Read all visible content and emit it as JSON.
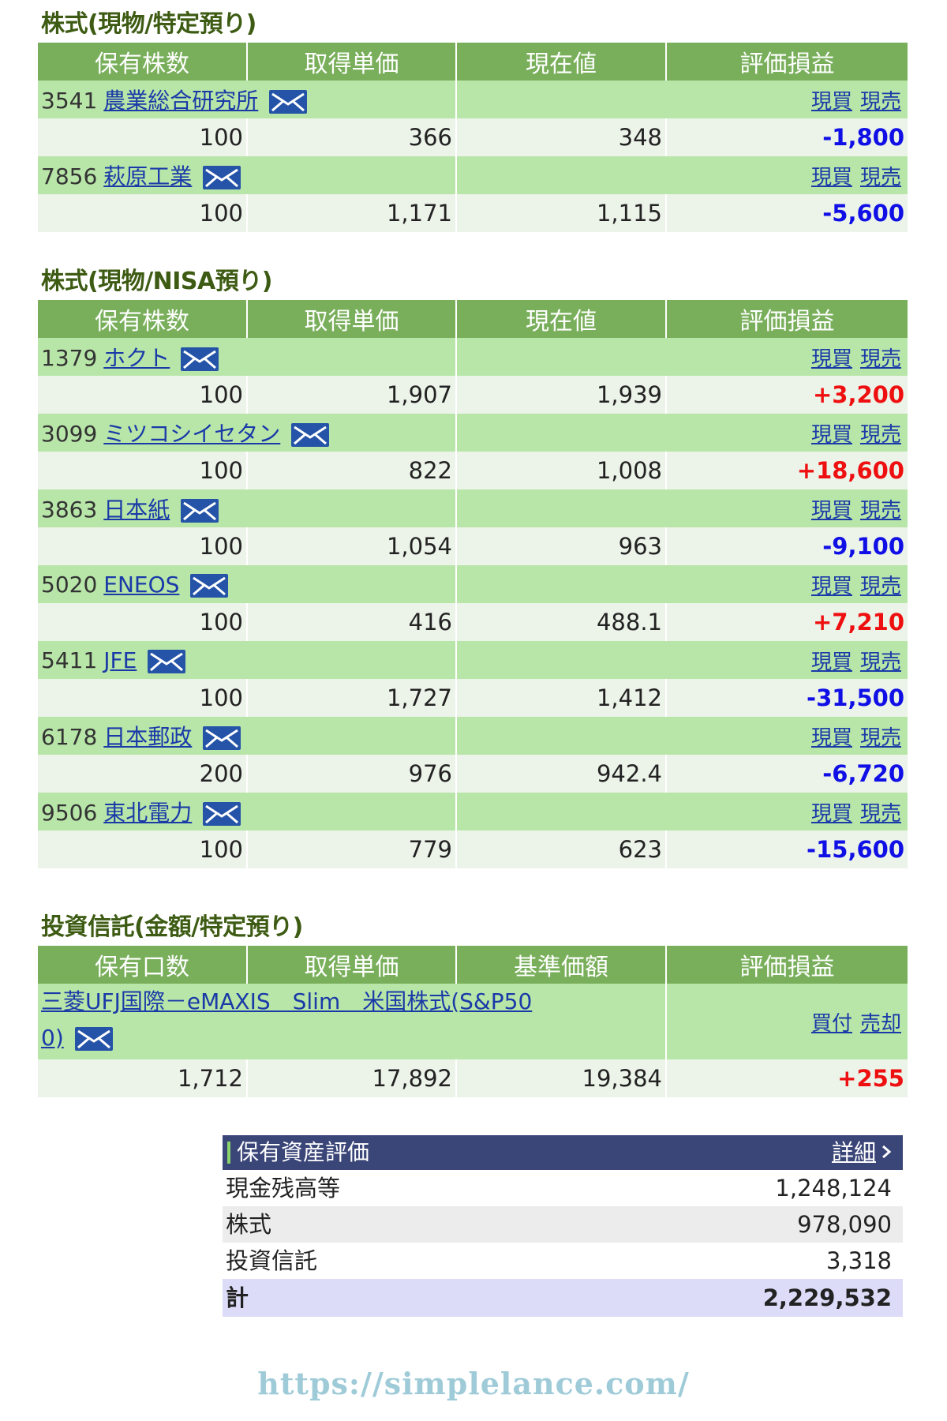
{
  "sections": [
    {
      "title": "株式(現物/特定預り)",
      "headers": [
        "保有株数",
        "取得単価",
        "現在値",
        "評価損益"
      ],
      "rows": [
        {
          "code": "3541",
          "name": "農業総合研究所",
          "qty": "100",
          "cost": "366",
          "price": "348",
          "pl": "-1,800",
          "sign": "neg"
        },
        {
          "code": "7856",
          "name": "萩原工業",
          "qty": "100",
          "cost": "1,171",
          "price": "1,115",
          "pl": "-5,600",
          "sign": "neg"
        }
      ]
    },
    {
      "title": "株式(現物/NISA預り)",
      "headers": [
        "保有株数",
        "取得単価",
        "現在値",
        "評価損益"
      ],
      "rows": [
        {
          "code": "1379",
          "name": "ホクト",
          "qty": "100",
          "cost": "1,907",
          "price": "1,939",
          "pl": "+3,200",
          "sign": "pos"
        },
        {
          "code": "3099",
          "name": "ミツコシイセタン",
          "qty": "100",
          "cost": "822",
          "price": "1,008",
          "pl": "+18,600",
          "sign": "pos"
        },
        {
          "code": "3863",
          "name": "日本紙",
          "qty": "100",
          "cost": "1,054",
          "price": "963",
          "pl": "-9,100",
          "sign": "neg"
        },
        {
          "code": "5020",
          "name": "ENEOS",
          "qty": "100",
          "cost": "416",
          "price": "488.1",
          "pl": "+7,210",
          "sign": "pos"
        },
        {
          "code": "5411",
          "name": "JFE",
          "qty": "100",
          "cost": "1,727",
          "price": "1,412",
          "pl": "-31,500",
          "sign": "neg"
        },
        {
          "code": "6178",
          "name": "日本郵政",
          "qty": "200",
          "cost": "976",
          "price": "942.4",
          "pl": "-6,720",
          "sign": "neg"
        },
        {
          "code": "9506",
          "name": "東北電力",
          "qty": "100",
          "cost": "779",
          "price": "623",
          "pl": "-15,600",
          "sign": "neg"
        }
      ]
    }
  ],
  "stock_actions": {
    "buy": "現買",
    "sell": "現売"
  },
  "fund_section": {
    "title": "投資信託(金額/特定預り)",
    "headers": [
      "保有口数",
      "取得単価",
      "基準価額",
      "評価損益"
    ],
    "fund": {
      "name_line1": "三菱UFJ国際－eMAXIS　Slim　米国株式(S&P50",
      "name_line2": "0)",
      "qty": "1,712",
      "cost": "17,892",
      "price": "19,384",
      "pl": "+255",
      "sign": "pos"
    },
    "actions": {
      "buy": "買付",
      "sell": "売却"
    }
  },
  "assets": {
    "title": "保有資産評価",
    "detail_label": "詳細",
    "rows": [
      {
        "label": "現金残高等",
        "value": "1,248,124"
      },
      {
        "label": "株式",
        "value": "978,090"
      },
      {
        "label": "投資信託",
        "value": "3,318"
      }
    ],
    "total": {
      "label": "計",
      "value": "2,229,532"
    }
  },
  "watermark": "https://simplelance.com/",
  "icons": {
    "mail": "mail-icon",
    "chevron": "chevron-right-icon"
  },
  "colors": {
    "header_green": "#79af5b",
    "name_row": "#b8e6a8",
    "value_row": "#ecf3e9",
    "negative": "#1010e6",
    "positive": "#ee1010",
    "assets_header": "#3a4578"
  }
}
